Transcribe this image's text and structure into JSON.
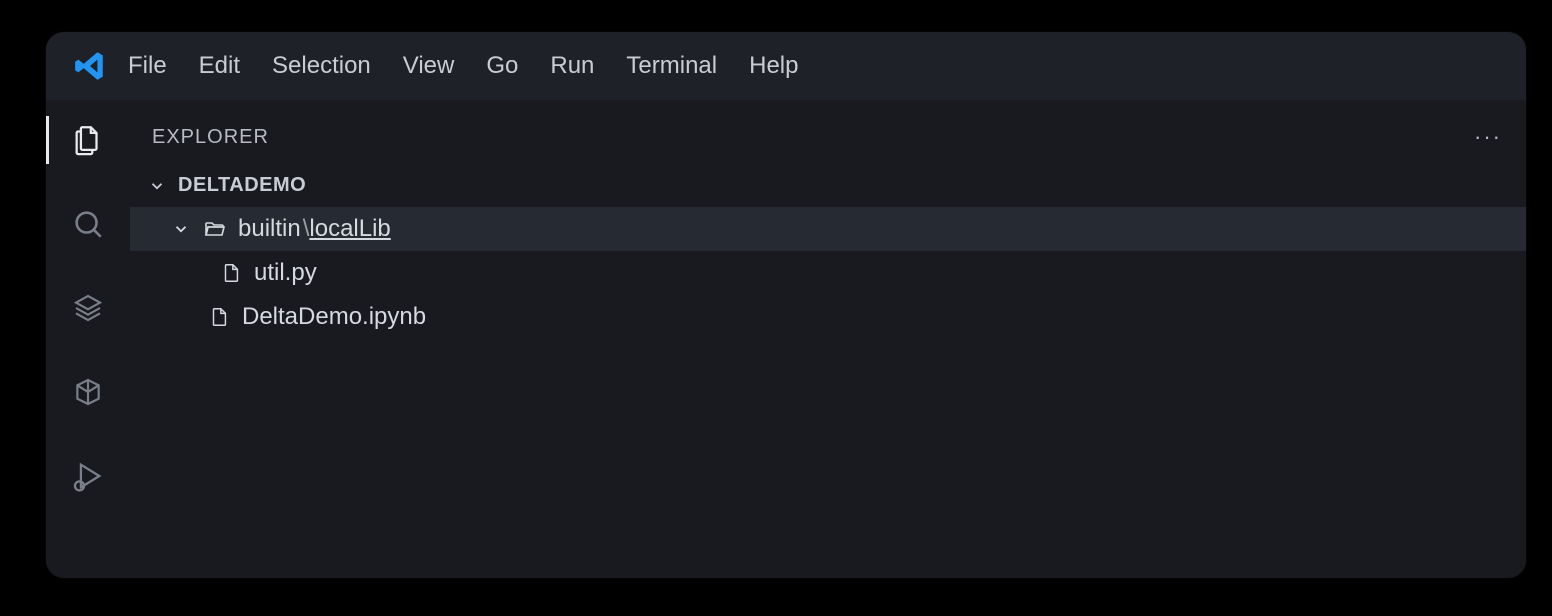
{
  "menu": {
    "items": [
      "File",
      "Edit",
      "Selection",
      "View",
      "Go",
      "Run",
      "Terminal",
      "Help"
    ]
  },
  "explorer": {
    "title": "EXPLORER",
    "root": "DELTADEMO",
    "folder_prefix": "builtin",
    "folder_sep": "\\",
    "folder_name": "localLib",
    "file1": "util.py",
    "file2": "DeltaDemo.ipynb"
  }
}
